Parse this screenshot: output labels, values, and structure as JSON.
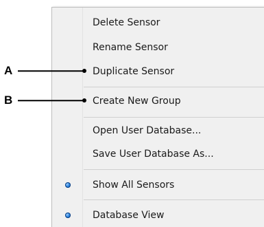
{
  "context_menu": {
    "items": [
      {
        "label": "Delete Sensor"
      },
      {
        "label": "Rename Sensor"
      },
      {
        "label": "Duplicate Sensor"
      },
      {
        "label": "Create New Group"
      },
      {
        "label": "Open User Database..."
      },
      {
        "label": "Save User Database As..."
      },
      {
        "label": "Show All Sensors",
        "selected": true
      },
      {
        "label": "Database View",
        "selected": true
      }
    ]
  },
  "callouts": {
    "a": {
      "letter": "A",
      "points_to": "Duplicate Sensor"
    },
    "b": {
      "letter": "B",
      "points_to": "Create New Group"
    }
  },
  "colors": {
    "menu_background": "#f0f0f0",
    "separator": "#cfcfcf",
    "radio_dot": "#2f86e0",
    "text": "#1a1a1a"
  }
}
